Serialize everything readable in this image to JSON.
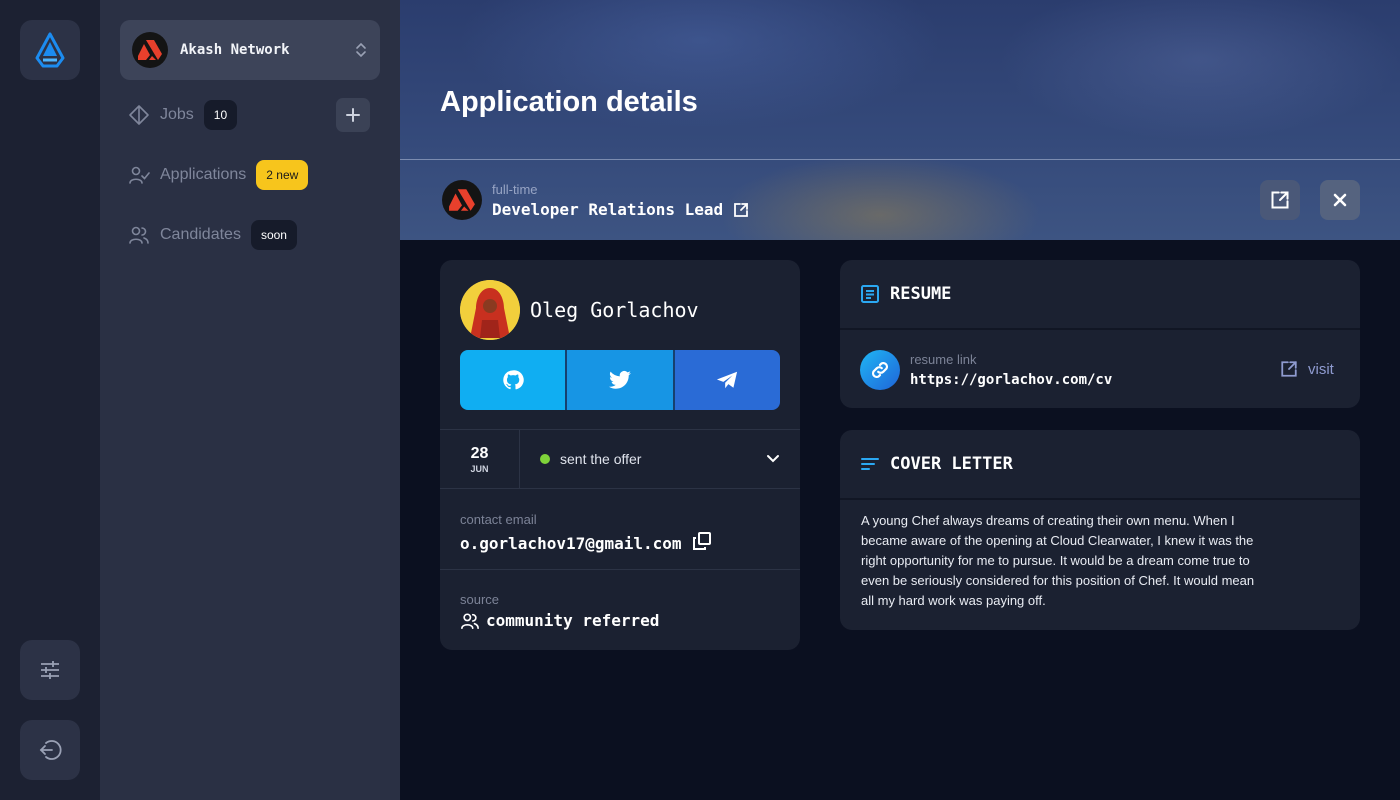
{
  "sidebar": {
    "org_name": "Akash Network",
    "nav": {
      "jobs_label": "Jobs",
      "jobs_count": "10",
      "applications_label": "Applications",
      "applications_badge": "2 new",
      "candidates_label": "Candidates",
      "candidates_badge": "soon"
    }
  },
  "header": {
    "title": "Application details",
    "job_type": "full-time",
    "job_title": "Developer Relations Lead"
  },
  "candidate": {
    "name": "Oleg Gorlachov",
    "date_day": "28",
    "date_month": "JUN",
    "status": "sent the offer",
    "email_label": "contact email",
    "email": "o.gorlachov17@gmail.com",
    "source_label": "source",
    "source": "community referred"
  },
  "resume": {
    "heading": "RESUME",
    "link_label": "resume link",
    "url": "https://gorlachov.com/cv",
    "visit_label": "visit"
  },
  "cover_letter": {
    "heading": "COVER LETTER",
    "text": "A young Chef always dreams of creating their own menu. When I became aware of the opening at Cloud Clearwater, I knew it was the right opportunity for me to pursue. It would be a dream come true to even be seriously considered for this position of Chef. It would mean all my hard work was paying off."
  },
  "colors": {
    "accent_blue": "#1795e4",
    "badge_yellow": "#f7c51c",
    "status_green": "#7fd33a",
    "brand_red": "#e8402c"
  },
  "icons": {
    "app_logo": "akash-logo-icon",
    "settings": "sliders-icon",
    "logout": "logout-icon",
    "github": "github-icon",
    "twitter": "twitter-icon",
    "telegram": "telegram-icon"
  }
}
